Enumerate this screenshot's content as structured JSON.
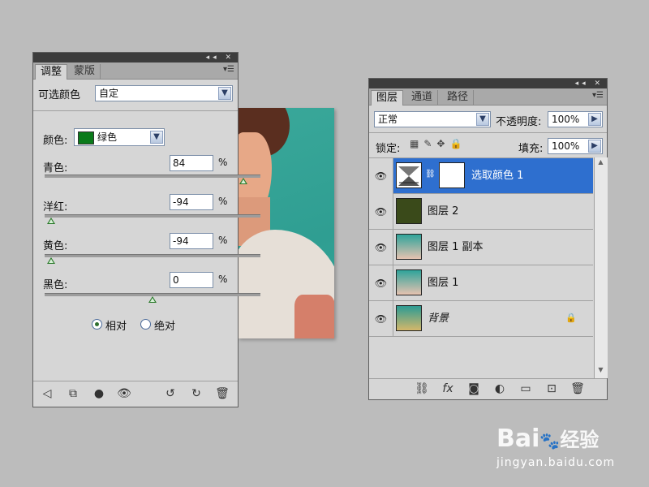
{
  "adjustments": {
    "tabs": [
      {
        "label": "调整"
      },
      {
        "label": "蒙版"
      }
    ],
    "title": "可选颜色",
    "preset_value": "自定",
    "colors_label": "颜色:",
    "color_value": "绿色",
    "color_swatch": "#0a7a1a",
    "sliders": [
      {
        "label": "青色:",
        "value": "84",
        "unit": "%",
        "level": 0.92
      },
      {
        "label": "洋红:",
        "value": "-94",
        "unit": "%",
        "level": 0.03
      },
      {
        "label": "黄色:",
        "value": "-94",
        "unit": "%",
        "level": 0.03
      },
      {
        "label": "黑色:",
        "value": "0",
        "unit": "%",
        "level": 0.5
      }
    ],
    "method": [
      {
        "label": "相对",
        "selected": true
      },
      {
        "label": "绝对",
        "selected": false
      }
    ]
  },
  "layers": {
    "tabs": [
      {
        "label": "图层"
      },
      {
        "label": "通道"
      },
      {
        "label": "路径"
      }
    ],
    "blend_mode": "正常",
    "opacity_label": "不透明度:",
    "opacity_value": "100%",
    "lock_label": "锁定:",
    "fill_label": "填充:",
    "fill_value": "100%",
    "items": [
      {
        "name": "选取颜色 1",
        "selected": true
      },
      {
        "name": "图层 2",
        "selected": false
      },
      {
        "name": "图层 1 副本",
        "selected": false
      },
      {
        "name": "图层 1",
        "selected": false
      },
      {
        "name": "背景",
        "selected": false
      }
    ]
  },
  "watermark": {
    "brand": "Bai",
    "suffix": "经验",
    "url": "jingyan.baidu.com"
  },
  "colors": {
    "selected": "#2e6fcf",
    "panel": "#d6d6d6",
    "layer2_fill": "#3a4a1a"
  }
}
